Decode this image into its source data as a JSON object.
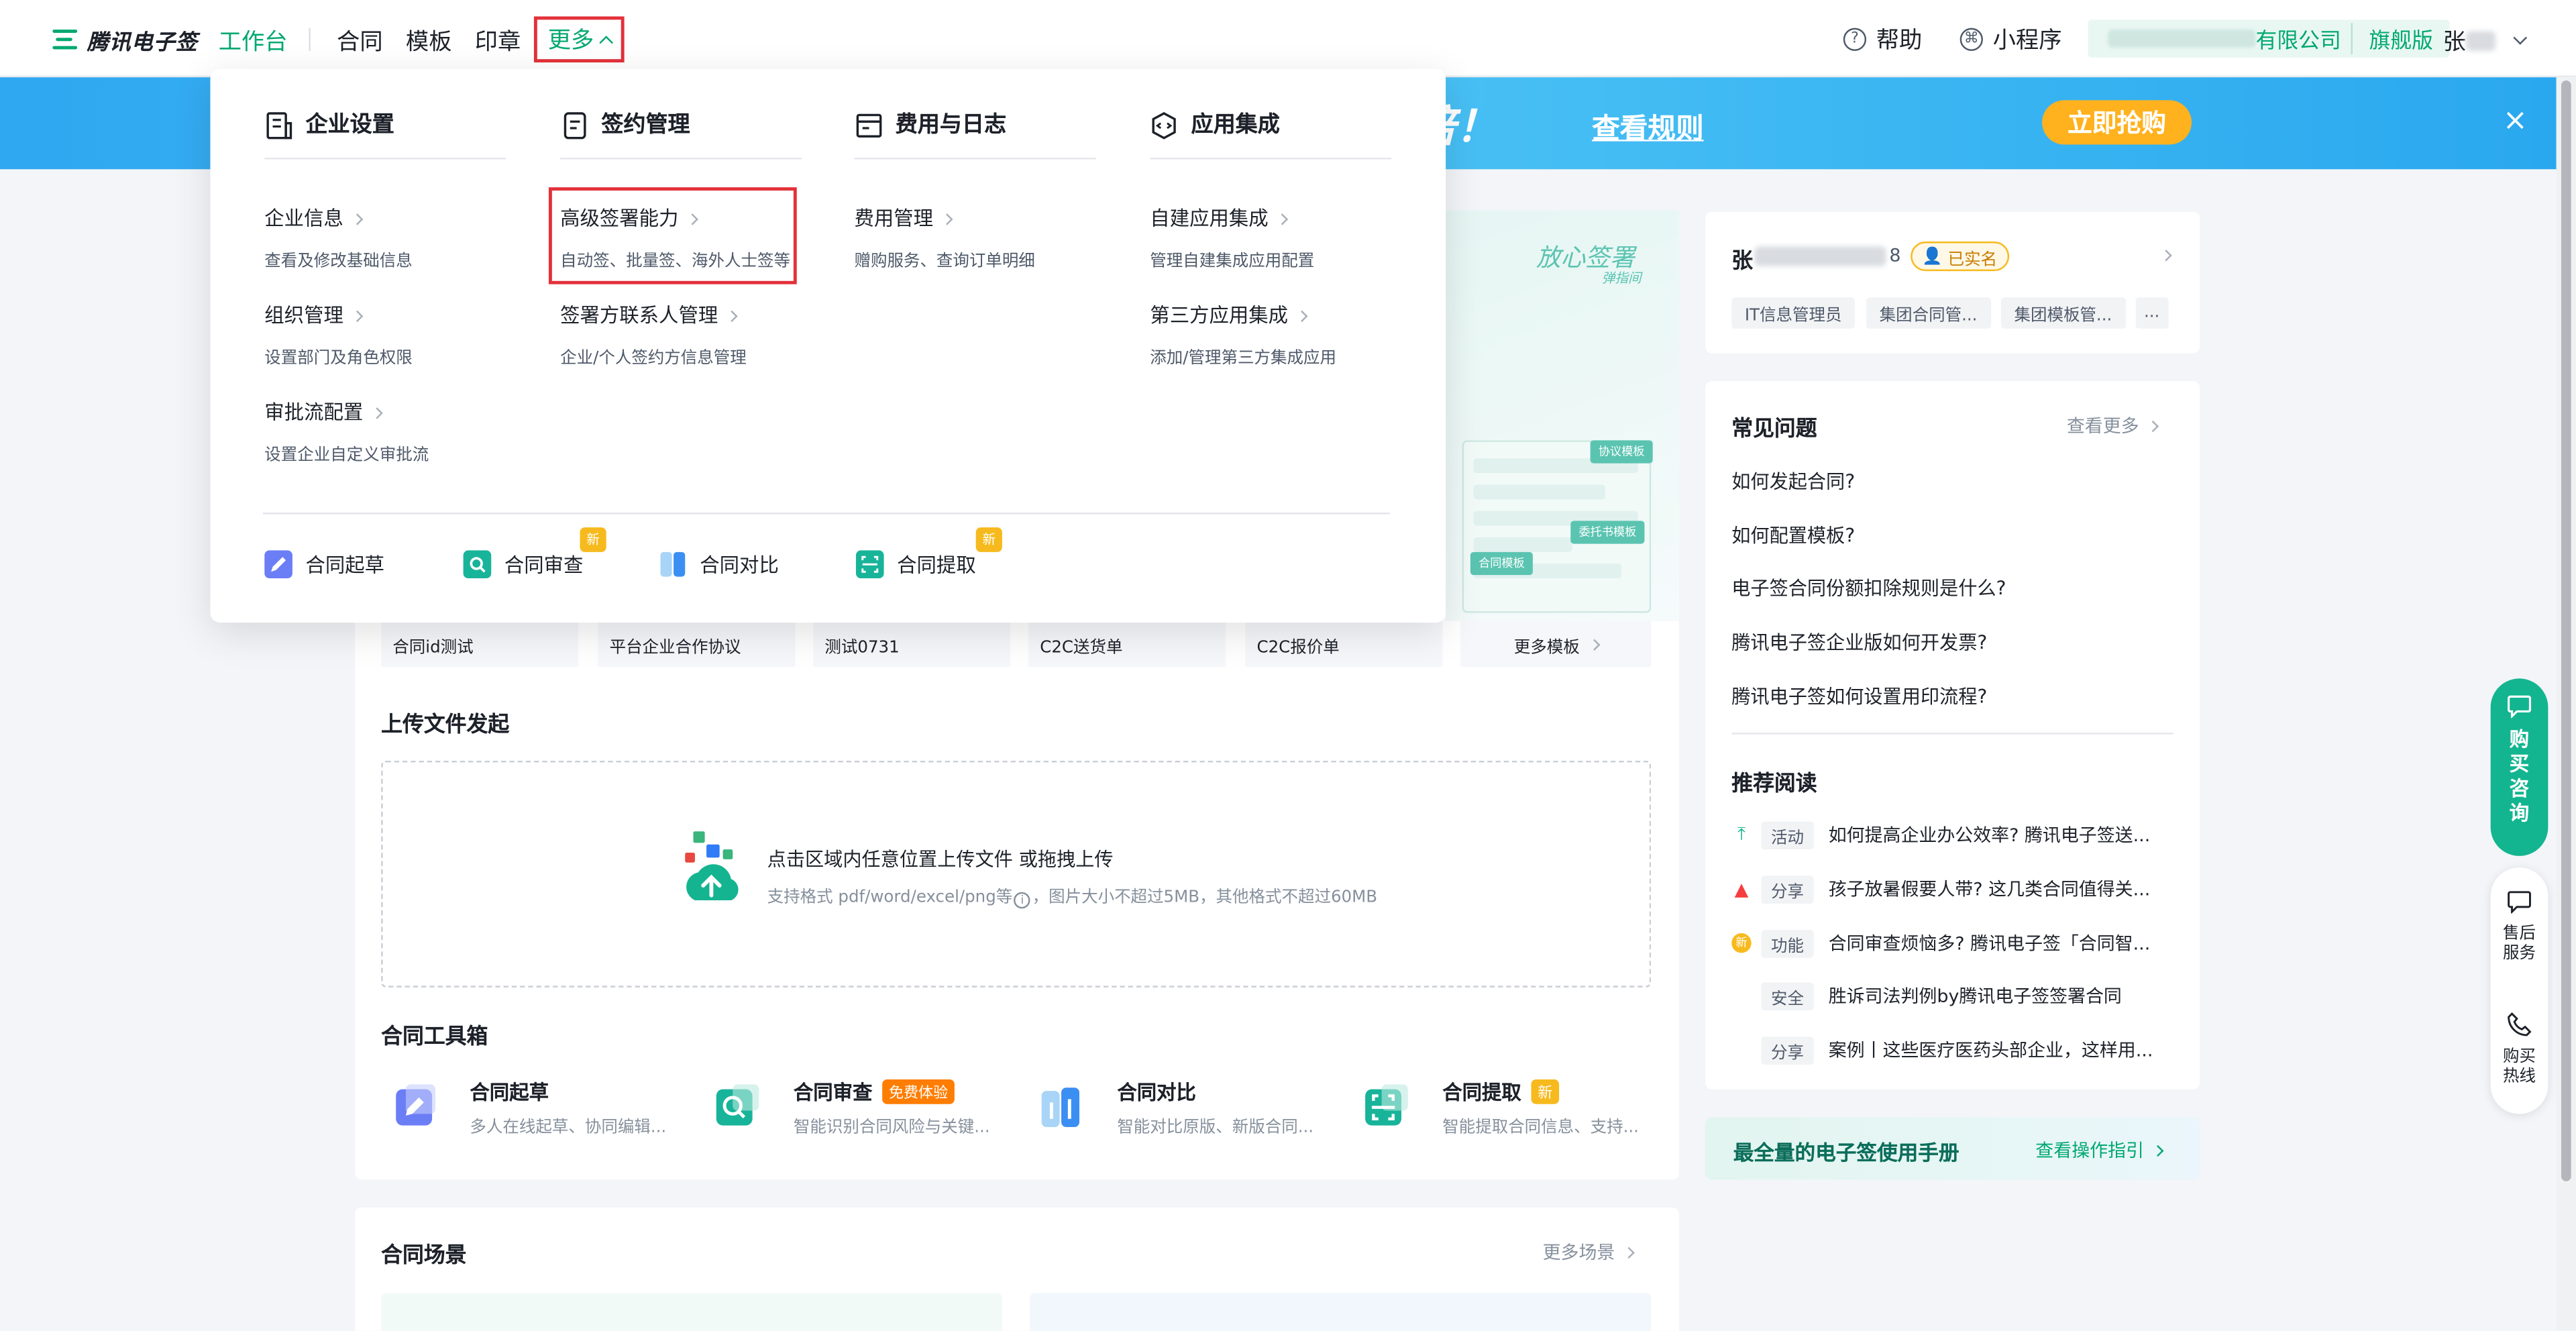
{
  "header": {
    "logo_text": "腾讯电子签",
    "nav": [
      "工作台",
      "合同",
      "模板",
      "印章"
    ],
    "more_label": "更多",
    "help_label": "帮助",
    "miniapp_label": "小程序",
    "company_suffix": "有限公司",
    "edition_label": "旗舰版",
    "user_initial": "张"
  },
  "banner": {
    "headline_fragment": "倍！",
    "rule_link": "查看规则",
    "cta_button": "立即抢购",
    "close_symbol": "×"
  },
  "dropdown": {
    "columns": [
      {
        "title": "企业设置",
        "items": [
          {
            "title": "企业信息",
            "desc": "查看及修改基础信息"
          },
          {
            "title": "组织管理",
            "desc": "设置部门及角色权限"
          },
          {
            "title": "审批流配置",
            "desc": "设置企业自定义审批流"
          }
        ]
      },
      {
        "title": "签约管理",
        "items": [
          {
            "title": "高级签署能力",
            "desc": "自动签、批量签、海外人士签等"
          },
          {
            "title": "签署方联系人管理",
            "desc": "企业/个人签约方信息管理"
          }
        ]
      },
      {
        "title": "费用与日志",
        "items": [
          {
            "title": "费用管理",
            "desc": "赠购服务、查询订单明细"
          }
        ]
      },
      {
        "title": "应用集成",
        "items": [
          {
            "title": "自建应用集成",
            "desc": "管理自建集成应用配置"
          },
          {
            "title": "第三方应用集成",
            "desc": "添加/管理第三方集成应用"
          }
        ]
      }
    ],
    "tools": [
      {
        "label": "合同起草"
      },
      {
        "label": "合同审查",
        "badge": "新"
      },
      {
        "label": "合同对比"
      },
      {
        "label": "合同提取",
        "badge": "新"
      }
    ]
  },
  "illustration": {
    "brand_script": "放心签署",
    "brand_sub": "弹指间",
    "tags": [
      "协议模板",
      "委托书模板",
      "合同模板"
    ]
  },
  "templates": [
    "合同id测试",
    "平台企业合作协议",
    "测试0731",
    "C2C送货单",
    "C2C报价单",
    "更多模板"
  ],
  "upload": {
    "title": "上传文件发起",
    "main_text": "点击区域内任意位置上传文件 或拖拽上传",
    "sub_text": "支持格式 pdf/word/excel/png等",
    "sub_text_2": "，图片大小不超过5MB，其他格式不超过60MB"
  },
  "toolbox": {
    "title": "合同工具箱",
    "tools": [
      {
        "name": "合同起草",
        "desc": "多人在线起草、协同编辑..."
      },
      {
        "name": "合同审查",
        "badge": "免费体验",
        "desc": "智能识别合同风险与关键..."
      },
      {
        "name": "合同对比",
        "desc": "智能对比原版、新版合同..."
      },
      {
        "name": "合同提取",
        "badge": "新",
        "desc": "智能提取合同信息、支持..."
      }
    ]
  },
  "scenes": {
    "title": "合同场景",
    "more": "更多场景"
  },
  "profile": {
    "name_initial": "张",
    "phone_tail": "8",
    "verified": "已实名",
    "roles": [
      "IT信息管理员",
      "集团合同管...",
      "集团模板管...",
      "..."
    ]
  },
  "faq": {
    "title": "常见问题",
    "more": "查看更多",
    "items": [
      "如何发起合同?",
      "如何配置模板?",
      "电子签合同份额扣除规则是什么?",
      "腾讯电子签企业版如何开发票?",
      "腾讯电子签如何设置用印流程?"
    ]
  },
  "reading": {
    "title": "推荐阅读",
    "items": [
      {
        "tag": "活动",
        "text": "如何提高企业办公效率? 腾讯电子签送..."
      },
      {
        "tag": "分享",
        "text": "孩子放暑假要人带? 这几类合同值得关..."
      },
      {
        "tag": "功能",
        "text": "合同审查烦恼多? 腾讯电子签「合同智..."
      },
      {
        "tag": "安全",
        "text": "胜诉司法判例by腾讯电子签签署合同"
      },
      {
        "tag": "分享",
        "text": "案例丨这些医疗医药头部企业，这样用..."
      }
    ],
    "new_icon_text": "新"
  },
  "manual": {
    "title": "最全量的电子签使用手册",
    "link": "查看操作指引"
  },
  "float": {
    "consult": "购买咨询",
    "after_sales": "售后服务",
    "hotline": "购买热线"
  },
  "colors": {
    "brand_green": "#00a870",
    "highlight_red": "#e3313a",
    "banner_blue": "#2fa7f1",
    "cta_orange": "#ffb21e"
  }
}
